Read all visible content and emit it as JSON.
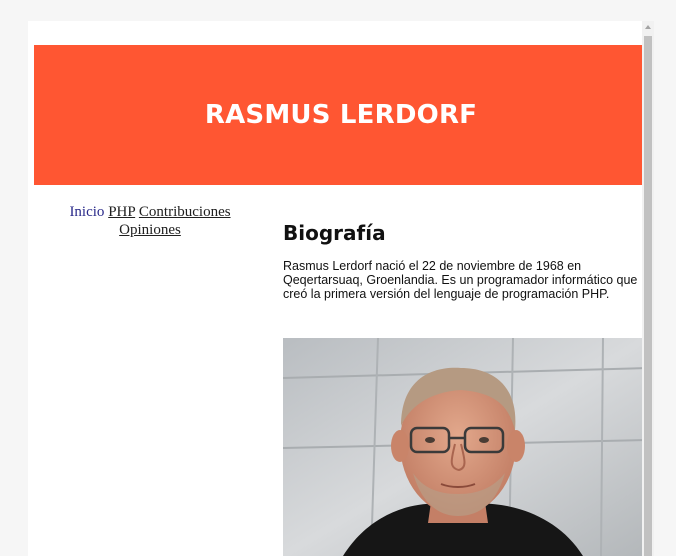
{
  "header": {
    "title": "RASMUS LERDORF"
  },
  "nav": {
    "items": [
      {
        "label": "Inicio"
      },
      {
        "label": "PHP"
      },
      {
        "label": "Contribuciones"
      },
      {
        "label": "Opiniones"
      }
    ]
  },
  "main": {
    "heading": "Biografía",
    "bio": "Rasmus Lerdorf nació el 22 de noviembre de 1968 en Qeqertarsuaq, Groenlandia. Es un programador informático que creó la primera versión del lenguaje de programación PHP."
  },
  "colors": {
    "banner": "#ff5632",
    "background": "#f6f6f6",
    "text": "#111111"
  }
}
